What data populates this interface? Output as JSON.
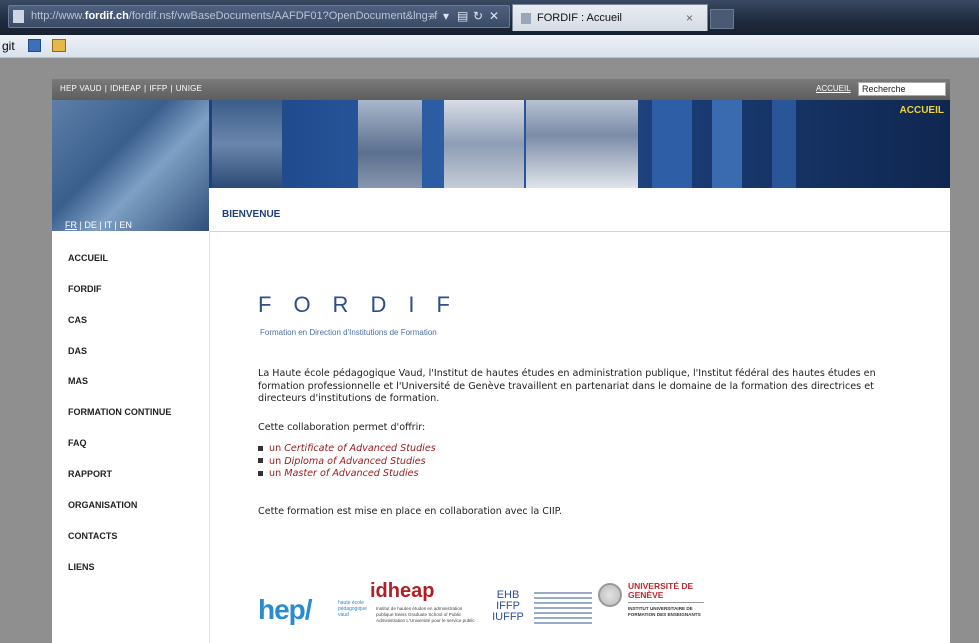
{
  "browser": {
    "url_prefix": "http://www.",
    "url_domain": "fordif.ch",
    "url_suffix": "/fordif.nsf/vwBaseDocuments/AAFDF01?OpenDocument&lng=f",
    "tab_title": "FORDIF : Accueil",
    "tab_close": "×",
    "cmd_text": "git"
  },
  "topbar": {
    "links": [
      "HEP VAUD",
      "IDHEAP",
      "IFFP",
      "UNIGE"
    ],
    "home_link": "ACCUEIL",
    "search_value": "Recherche"
  },
  "banner": {
    "label": "ACCUEIL"
  },
  "languages": [
    "FR",
    "DE",
    "IT",
    "EN"
  ],
  "section_title": "BIENVENUE",
  "nav": [
    "ACCUEIL",
    "FORDIF",
    "CAS",
    "DAS",
    "MAS",
    "FORMATION CONTINUE",
    "FAQ",
    "RAPPORT",
    "ORGANISATION",
    "CONTACTS",
    "LIENS"
  ],
  "main": {
    "brand": "FORDIF",
    "brand_subtitle": "Formation en Direction d'Institutions de Formation",
    "intro": "La Haute école pédagogique Vaud, l'Institut de hautes études en administration publique, l'Institut fédéral des hautes études en formation professionnelle et l'Université de Genève travaillent en partenariat dans le domaine de la formation des directrices et directeurs d'institutions de formation.",
    "collab_lead": "Cette collaboration permet d'offrir:",
    "offers": [
      {
        "prefix": "un ",
        "link": "Certificate of Advanced Studies"
      },
      {
        "prefix": "un ",
        "link": "Diploma of Advanced Studies"
      },
      {
        "prefix": "un ",
        "link": "Master of Advanced Studies"
      }
    ],
    "ciip": "Cette formation est mise en place en collaboration avec la CIIP."
  },
  "logos": {
    "hep": "hep/",
    "hep_sub": "haute école pédagogique vaud",
    "idheap": "idheap",
    "idheap_sub": "Institut de hautes études en administration publique Swiss Graduate School of Public Administration L'Université pour le service public",
    "ehb": "EHB IFFP IUFFP",
    "unige": "UNIVERSITÉ DE GENÈVE",
    "unige_sub": "INSTITUT UNIVERSITAIRE DE FORMATION DES ENSEIGNANTS"
  }
}
